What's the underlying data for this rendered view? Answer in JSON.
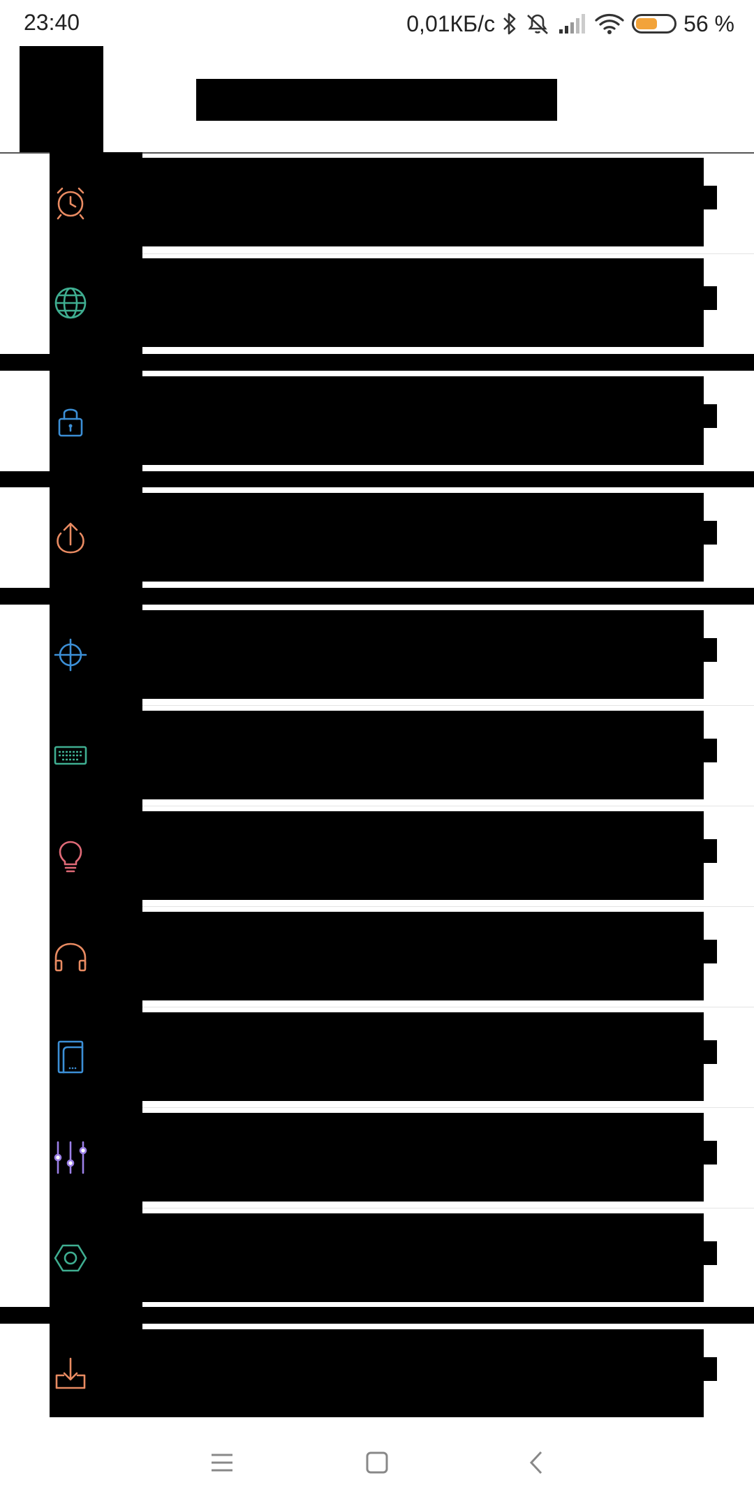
{
  "status_bar": {
    "time": "23:40",
    "network_speed": "0,01КБ/с",
    "battery_percent": "56 %",
    "icons": [
      "bluetooth-icon",
      "alarm-off-icon",
      "signal-icon",
      "wifi-icon",
      "battery-icon"
    ],
    "battery_level": 0.56,
    "battery_color": "#f2a33a"
  },
  "header": {
    "title": ""
  },
  "settings": {
    "items": [
      {
        "key": "alarm",
        "icon": "alarm-clock-icon",
        "color": "#e98b62",
        "label": ""
      },
      {
        "key": "language",
        "icon": "globe-icon",
        "color": "#3fae91",
        "label": ""
      },
      {
        "key": "lock",
        "icon": "lock-icon",
        "color": "#3c8fd6",
        "label": ""
      },
      {
        "key": "upload",
        "icon": "upload-icon",
        "color": "#e98b62",
        "label": ""
      },
      {
        "key": "location",
        "icon": "crosshair-icon",
        "color": "#3c8fd6",
        "label": ""
      },
      {
        "key": "keyboard",
        "icon": "keyboard-icon",
        "color": "#3fae91",
        "label": ""
      },
      {
        "key": "tips",
        "icon": "lightbulb-icon",
        "color": "#e06a77",
        "label": ""
      },
      {
        "key": "audio",
        "icon": "headphones-icon",
        "color": "#e98b62",
        "label": ""
      },
      {
        "key": "tablet",
        "icon": "tablet-icon",
        "color": "#3c8fd6",
        "label": ""
      },
      {
        "key": "equalizer",
        "icon": "sliders-icon",
        "color": "#9b7fe6",
        "label": ""
      },
      {
        "key": "advanced",
        "icon": "hexagon-nut-icon",
        "color": "#3fae91",
        "label": ""
      },
      {
        "key": "download",
        "icon": "download-icon",
        "color": "#e98b62",
        "label": ""
      }
    ]
  },
  "nav_bar": {
    "buttons": [
      "menu-icon",
      "home-square-icon",
      "back-chevron-icon"
    ]
  }
}
